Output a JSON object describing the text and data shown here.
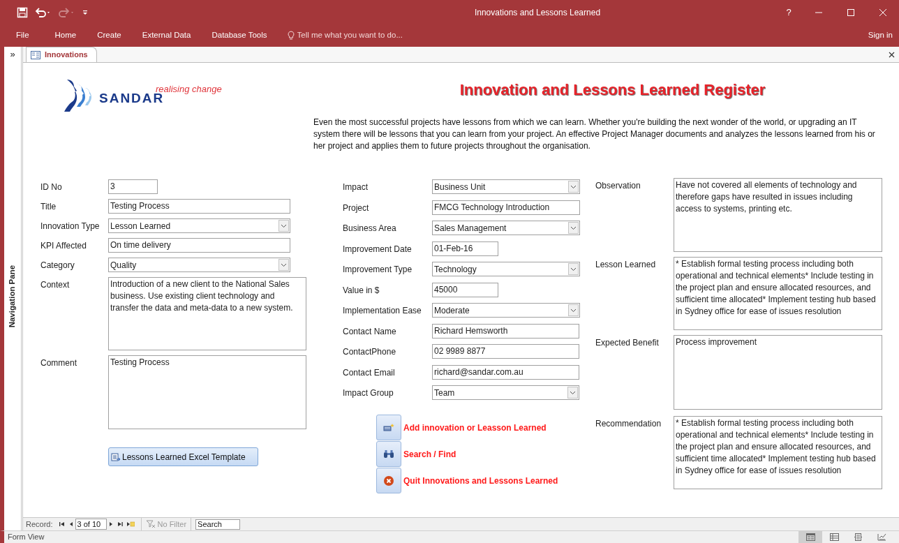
{
  "window": {
    "title": "Innovations and Lessons Learned",
    "help": "?"
  },
  "ribbon": {
    "tabs": [
      {
        "label": "File"
      },
      {
        "label": "Home"
      },
      {
        "label": "Create"
      },
      {
        "label": "External Data"
      },
      {
        "label": "Database Tools"
      }
    ],
    "tell_me": {
      "placeholder": "Tell me what you want to do..."
    },
    "sign_in": "Sign in"
  },
  "navigation_pane": {
    "label": "Navigation Pane",
    "toggle": "»"
  },
  "document_tabs": [
    {
      "label": "Innovations",
      "selected": true
    }
  ],
  "form": {
    "logo": {
      "name": "SANDAR",
      "tagline": "realising change"
    },
    "title": "Innovation and Lessons Learned Register",
    "intro": "Even the most successful projects have lessons from which we can learn.  Whether you're building the next wonder of the world, or upgrading an IT system there will be lessons that you can learn from your project.  An effective Project Manager documents and analyzes the lessons learned from his or her project and applies them to future projects throughout the organisation.",
    "left_fields": [
      {
        "label": "ID No",
        "value": "3",
        "kind": "text"
      },
      {
        "label": "Title",
        "value": "Testing Process",
        "kind": "text"
      },
      {
        "label": "Innovation Type",
        "value": "Lesson Learned",
        "kind": "combo"
      },
      {
        "label": "KPI Affected",
        "value": "On time delivery",
        "kind": "text"
      },
      {
        "label": "Category",
        "value": "Quality",
        "kind": "combo"
      },
      {
        "label": "Context",
        "value": "Introduction of a new client to the National Sales business.  Use existing client technology and transfer the data and meta-data to a new system.",
        "kind": "memo"
      },
      {
        "label": "Comment",
        "value": "Testing Process",
        "kind": "memo"
      }
    ],
    "template_button": {
      "label": "Lessons Learned Excel Template"
    },
    "middle_fields": [
      {
        "label": "Impact",
        "value": "Business Unit",
        "kind": "combo"
      },
      {
        "label": "Project",
        "value": "FMCG Technology Introduction",
        "kind": "text"
      },
      {
        "label": "Business Area",
        "value": "Sales Management",
        "kind": "combo"
      },
      {
        "label": "Improvement Date",
        "value": "01-Feb-16",
        "kind": "text"
      },
      {
        "label": "Improvement Type",
        "value": "Technology",
        "kind": "combo"
      },
      {
        "label": "Value in $",
        "value": "45000",
        "kind": "text"
      },
      {
        "label": "Implementation Ease",
        "value": "Moderate",
        "kind": "combo"
      },
      {
        "label": "Contact Name",
        "value": "Richard Hemsworth",
        "kind": "text"
      },
      {
        "label": "ContactPhone",
        "value": "02 9989 8877",
        "kind": "text"
      },
      {
        "label": "Contact Email",
        "value": "richard@sandar.com.au",
        "kind": "text"
      },
      {
        "label": "Impact Group",
        "value": "Team",
        "kind": "combo"
      }
    ],
    "action_buttons": [
      {
        "label": "Add innovation or Leasson Learned",
        "kind": "add"
      },
      {
        "label": "Search / Find",
        "kind": "search"
      },
      {
        "label": "Quit Innovations and Lessons Learned",
        "kind": "quit"
      }
    ],
    "right_fields": [
      {
        "label": "Observation",
        "value": "Have not covered all elements of technology and therefore gaps have resulted in issues including access to systems, printing etc.",
        "kind": "memo"
      },
      {
        "label": "Lesson Learned",
        "value": "* Establish formal testing process including both operational and technical elements* Include testing in the project plan and ensure allocated resources, and sufficient time allocated* Implement testing hub based in Sydney office for ease of issues resolution",
        "kind": "memo"
      },
      {
        "label": "Expected Benefit",
        "value": "Process improvement",
        "kind": "memo"
      },
      {
        "label": "Recommendation",
        "value": "* Establish formal testing process including both operational and technical elements* Include testing in the project plan and ensure allocated resources, and sufficient time allocated* Implement testing hub based in Sydney office for ease of issues resolution",
        "kind": "memo"
      }
    ]
  },
  "record_navigator": {
    "label": "Record:",
    "position": "3 of 10",
    "filter": {
      "label": "No Filter",
      "disabled": true
    },
    "search": {
      "placeholder": "Search"
    }
  },
  "status_bar": {
    "text": "Form View",
    "views": [
      {
        "selected": true
      },
      {
        "selected": false
      },
      {
        "selected": false
      },
      {
        "selected": false
      }
    ]
  }
}
